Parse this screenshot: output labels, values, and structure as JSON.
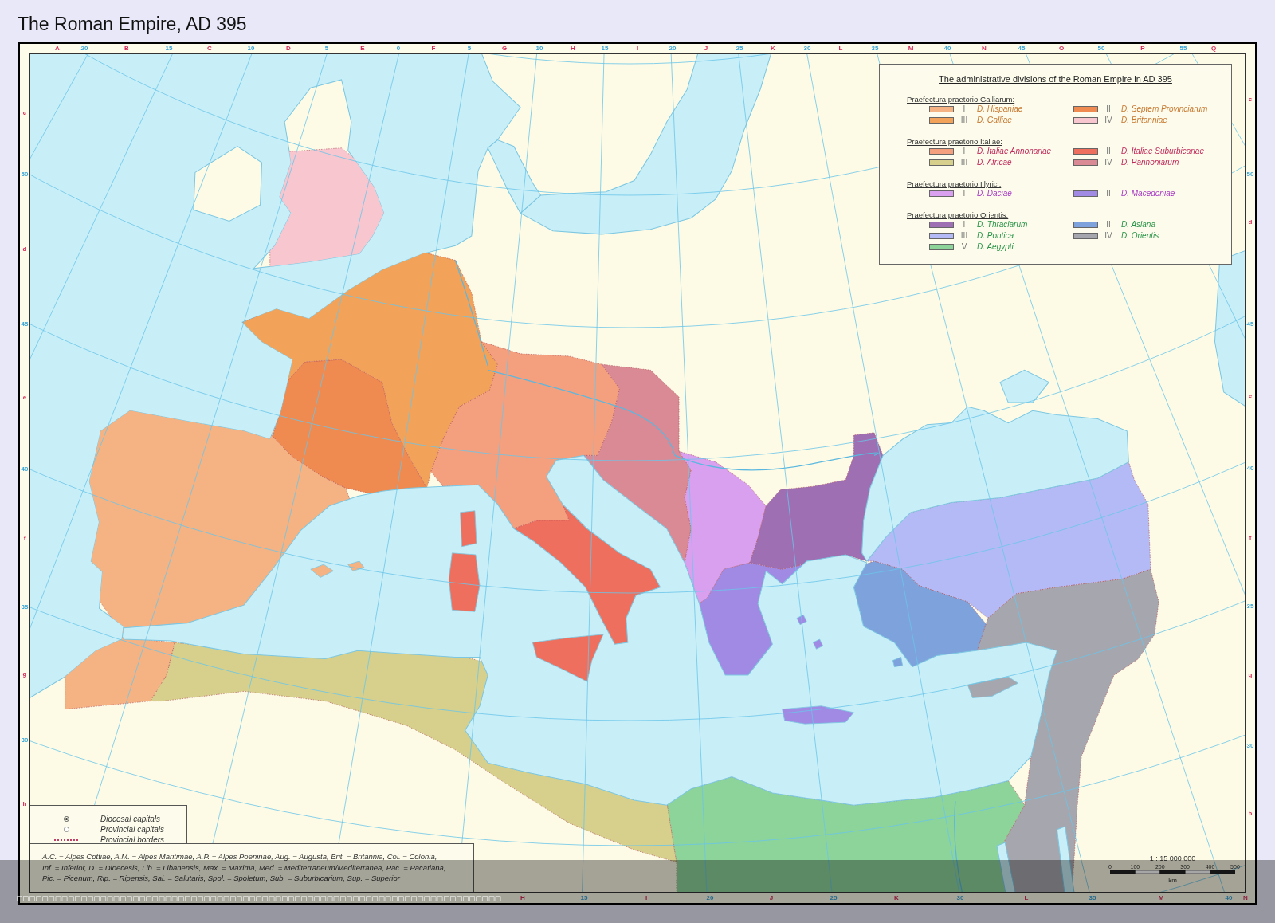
{
  "title": "The Roman Empire, AD 395",
  "frame": {
    "top_labels": [
      {
        "text": "A",
        "kind": "letter"
      },
      {
        "text": "20",
        "kind": "degree"
      },
      {
        "text": "B",
        "kind": "letter"
      },
      {
        "text": "15",
        "kind": "degree"
      },
      {
        "text": "C",
        "kind": "letter"
      },
      {
        "text": "10",
        "kind": "degree"
      },
      {
        "text": "D",
        "kind": "letter"
      },
      {
        "text": "5",
        "kind": "degree"
      },
      {
        "text": "E",
        "kind": "letter"
      },
      {
        "text": "0",
        "kind": "degree"
      },
      {
        "text": "F",
        "kind": "letter"
      },
      {
        "text": "5",
        "kind": "degree"
      },
      {
        "text": "G",
        "kind": "letter"
      },
      {
        "text": "10",
        "kind": "degree"
      },
      {
        "text": "H",
        "kind": "letter"
      },
      {
        "text": "15",
        "kind": "degree"
      },
      {
        "text": "I",
        "kind": "letter"
      },
      {
        "text": "20",
        "kind": "degree"
      },
      {
        "text": "J",
        "kind": "letter"
      },
      {
        "text": "25",
        "kind": "degree"
      },
      {
        "text": "K",
        "kind": "letter"
      },
      {
        "text": "30",
        "kind": "degree"
      },
      {
        "text": "L",
        "kind": "letter"
      },
      {
        "text": "35",
        "kind": "degree"
      },
      {
        "text": "M",
        "kind": "letter"
      },
      {
        "text": "40",
        "kind": "degree"
      },
      {
        "text": "N",
        "kind": "letter"
      },
      {
        "text": "45",
        "kind": "degree"
      },
      {
        "text": "O",
        "kind": "letter"
      },
      {
        "text": "50",
        "kind": "degree"
      },
      {
        "text": "P",
        "kind": "letter"
      },
      {
        "text": "55",
        "kind": "degree"
      },
      {
        "text": "Q",
        "kind": "letter"
      }
    ],
    "bottom_labels": [
      {
        "text": "H",
        "kind": "letter"
      },
      {
        "text": "15",
        "kind": "degree"
      },
      {
        "text": "I",
        "kind": "letter"
      },
      {
        "text": "20",
        "kind": "degree"
      },
      {
        "text": "J",
        "kind": "letter"
      },
      {
        "text": "25",
        "kind": "degree"
      },
      {
        "text": "K",
        "kind": "letter"
      },
      {
        "text": "30",
        "kind": "degree"
      },
      {
        "text": "L",
        "kind": "letter"
      },
      {
        "text": "35",
        "kind": "degree"
      },
      {
        "text": "M",
        "kind": "letter"
      },
      {
        "text": "40",
        "kind": "degree"
      },
      {
        "text": "N",
        "kind": "letter"
      }
    ],
    "left_labels": [
      {
        "text": "c",
        "kind": "letter"
      },
      {
        "text": "50",
        "kind": "degree"
      },
      {
        "text": "d",
        "kind": "letter"
      },
      {
        "text": "45",
        "kind": "degree"
      },
      {
        "text": "e",
        "kind": "letter"
      },
      {
        "text": "40",
        "kind": "degree"
      },
      {
        "text": "f",
        "kind": "letter"
      },
      {
        "text": "35",
        "kind": "degree"
      },
      {
        "text": "g",
        "kind": "letter"
      },
      {
        "text": "30",
        "kind": "degree"
      },
      {
        "text": "h",
        "kind": "letter"
      }
    ],
    "right_labels": [
      {
        "text": "c",
        "kind": "letter"
      },
      {
        "text": "50",
        "kind": "degree"
      },
      {
        "text": "d",
        "kind": "letter"
      },
      {
        "text": "45",
        "kind": "degree"
      },
      {
        "text": "e",
        "kind": "letter"
      },
      {
        "text": "40",
        "kind": "degree"
      },
      {
        "text": "f",
        "kind": "letter"
      },
      {
        "text": "35",
        "kind": "degree"
      },
      {
        "text": "g",
        "kind": "letter"
      },
      {
        "text": "30",
        "kind": "degree"
      },
      {
        "text": "h",
        "kind": "letter"
      }
    ]
  },
  "legend": {
    "title": "The administrative divisions of the Roman Empire in AD 395",
    "prefectures": [
      {
        "name": "Praefectura praetorio Galliarum:",
        "color": "#c7772f",
        "dioceses": [
          {
            "numeral": "I",
            "name": "D. Hispaniae",
            "color": "#f5b283"
          },
          {
            "numeral": "II",
            "name": "D. Septem Provinciarum",
            "color": "#ef8a50"
          },
          {
            "numeral": "III",
            "name": "D. Galliae",
            "color": "#f3a259"
          },
          {
            "numeral": "IV",
            "name": "D. Britanniae",
            "color": "#f7c6cf"
          }
        ]
      },
      {
        "name": "Praefectura praetorio Italiae:",
        "color": "#c02a5c",
        "dioceses": [
          {
            "numeral": "I",
            "name": "D. Italiae Annonariae",
            "color": "#f4a07e"
          },
          {
            "numeral": "II",
            "name": "D. Italiae Suburbicariae",
            "color": "#ee6f5d"
          },
          {
            "numeral": "III",
            "name": "D. Africae",
            "color": "#d6d08c"
          },
          {
            "numeral": "IV",
            "name": "D. Pannoniarum",
            "color": "#d98a95"
          }
        ]
      },
      {
        "name": "Praefectura praetorio Illyrici:",
        "color": "#a93bc4",
        "dioceses": [
          {
            "numeral": "I",
            "name": "D. Daciae",
            "color": "#d9a0f0"
          },
          {
            "numeral": "II",
            "name": "D. Macedoniae",
            "color": "#a08ae4"
          }
        ]
      },
      {
        "name": "Praefectura praetorio Orientis:",
        "color": "#2a9448",
        "dioceses": [
          {
            "numeral": "I",
            "name": "D. Thraciarum",
            "color": "#9e6fb3"
          },
          {
            "numeral": "II",
            "name": "D. Asiana",
            "color": "#7ea2dc"
          },
          {
            "numeral": "III",
            "name": "D. Pontica",
            "color": "#b4baf6"
          },
          {
            "numeral": "IV",
            "name": "D. Orientis",
            "color": "#a6a6ae"
          },
          {
            "numeral": "V",
            "name": "D. Aegypti",
            "color": "#8dd49a"
          }
        ]
      }
    ]
  },
  "symbols": [
    {
      "kind": "diocesal_capital",
      "label": "Diocesal capitals"
    },
    {
      "kind": "provincial_capital",
      "label": "Provincial capitals"
    },
    {
      "kind": "border",
      "label": "Provincial borders"
    }
  ],
  "abbreviations": {
    "lines": [
      "A.C. = Alpes Cottiae, A.M. = Alpes Maritimae, A.P. = Alpes Poeninae, Aug. = Augusta, Brit. = Britannia, Col. = Colonia,",
      "Inf. = Inferior, D. = Dioecesis, Lib. = Libanensis, Max. = Maxima, Med. = Mediterraneum/Mediterranea, Pac. = Pacatiana,",
      "Pic. = Picenum, Rip. = Ripensis, Sal. = Salutaris, Spol. = Spoletum, Sub. = Suburbicarium, Sup. = Superior"
    ]
  },
  "scale": {
    "ratio": "1 : 15 000 000",
    "ticks": [
      "0",
      "100",
      "200",
      "300",
      "400",
      "500"
    ],
    "unit": "km"
  },
  "caption": "□□□□□□□□□□□□□□□□□□□□□□□□□□□□□□□□□□□□□□□□□□□□□□□□□□□□□□□□□□□□□□□□□□□□□□□□□□□"
}
